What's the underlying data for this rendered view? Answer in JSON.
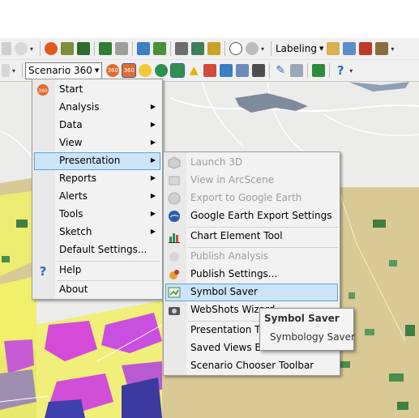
{
  "toolbar_top": {
    "labeling_label": "Labeling"
  },
  "toolbar_second": {
    "scenario_button_label": "Scenario 360"
  },
  "scenario_menu": {
    "items": [
      {
        "label": "Start",
        "icon": "scenario360-icon"
      },
      {
        "label": "Analysis",
        "has_submenu": true
      },
      {
        "label": "Data",
        "has_submenu": true
      },
      {
        "label": "View",
        "has_submenu": true
      },
      {
        "label": "Presentation",
        "has_submenu": true,
        "highlighted": true
      },
      {
        "label": "Reports",
        "has_submenu": true
      },
      {
        "label": "Alerts",
        "has_submenu": true
      },
      {
        "label": "Tools",
        "has_submenu": true
      },
      {
        "label": "Sketch",
        "has_submenu": true
      },
      {
        "label": "Default Settings..."
      },
      {
        "label": "Help",
        "icon": "help-icon"
      },
      {
        "label": "About"
      }
    ]
  },
  "presentation_submenu": {
    "items": [
      {
        "label": "Launch 3D",
        "disabled": true
      },
      {
        "label": "View in ArcScene",
        "disabled": true
      },
      {
        "label": "Export to Google Earth",
        "disabled": true
      },
      {
        "label": "Google Earth Export Settings"
      },
      {
        "label": "Chart Element Tool"
      },
      {
        "label": "Publish Analysis",
        "disabled": true
      },
      {
        "label": "Publish Settings..."
      },
      {
        "label": "Symbol Saver",
        "highlighted": true
      },
      {
        "label": "WebShots Wizard"
      },
      {
        "label": "Presentation Tools"
      },
      {
        "label": "Saved Views Browser"
      },
      {
        "label": "Scenario Chooser Toolbar"
      }
    ]
  },
  "tooltip": {
    "title": "Symbol Saver",
    "body": "Symbology Saver"
  },
  "colors": {
    "highlight_bg": "#cce4f7",
    "highlight_border": "#5fa2d9",
    "menu_bg": "#f2f2f2",
    "disabled_text": "#9d9d9d"
  }
}
